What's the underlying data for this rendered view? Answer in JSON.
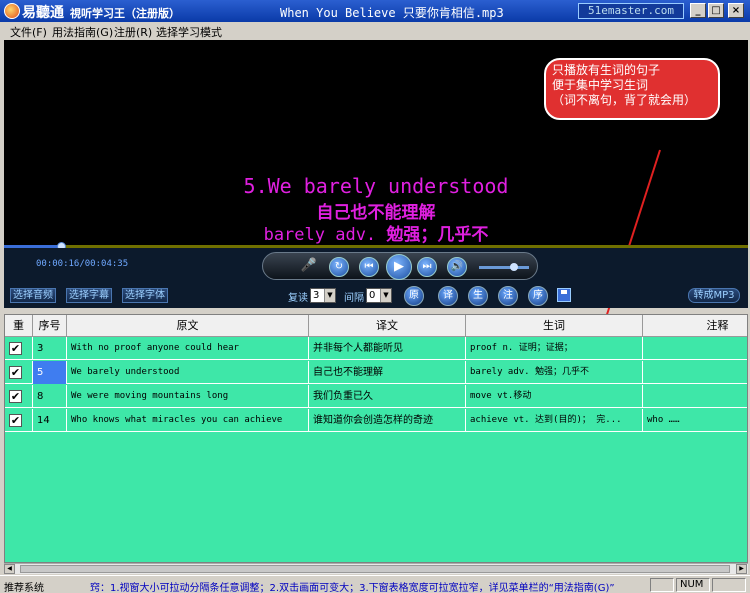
{
  "titlebar": {
    "app_name": "易聽通",
    "app_subtitle": "視听学习王（注册版）",
    "document": "When You Believe 只要你肯相信.mp3",
    "brand": "51emaster.com",
    "min": "_",
    "max": "□",
    "close": "×"
  },
  "menu": {
    "items": [
      "文件(F)",
      "用法指南(G)",
      "注册(R)",
      "选择学习模式"
    ]
  },
  "subtitles": {
    "line1": "5.We barely understood",
    "line2": "自己也不能理解",
    "line3_word": "barely adv.",
    "line3_def": "勉强；几乎不"
  },
  "callout": {
    "line1": "只播放有生词的句子",
    "line2": "便于集中学习生词",
    "line3": "（词不离句，背了就会用）"
  },
  "player": {
    "time": "00:00:16/00:04:35",
    "progress": 0.077,
    "volume": 0.7,
    "buttons": {
      "mic": "🎤",
      "repeat": "↻",
      "prev": "⏮",
      "play": "▶",
      "next": "⏭",
      "volume": "🔊"
    }
  },
  "toolbar": {
    "select_audio": "选择音频",
    "select_subtitle": "选择字幕",
    "select_font": "选择字体",
    "repeat_label": "复读",
    "repeat_value": "3",
    "interval_label": "间隔",
    "interval_value": "0",
    "circle_buttons": [
      "原",
      "译",
      "生",
      "注",
      "序"
    ],
    "to_mp3": "转成MP3"
  },
  "table": {
    "headers": [
      "重",
      "序号",
      "原文",
      "译文",
      "生词",
      "注释"
    ],
    "rows": [
      {
        "checked": "✔",
        "num": "3",
        "original": "With no proof anyone could hear",
        "translation": "并非每个人都能听见",
        "vocab": "proof n. 证明；证据；",
        "note": ""
      },
      {
        "checked": "✔",
        "num": "5",
        "original": "We barely understood",
        "translation": "自己也不能理解",
        "vocab": "barely adv. 勉强；几乎不",
        "note": ""
      },
      {
        "checked": "✔",
        "num": "8",
        "original": "We were moving mountains long",
        "translation": "我们负重已久",
        "vocab": "move vt.移动",
        "note": ""
      },
      {
        "checked": "✔",
        "num": "14",
        "original": "Who knows what miracles you can achieve",
        "translation": "谁知道你会创造怎样的奇迹",
        "vocab": "achieve vt. 达到(目的)； 完...",
        "note": "who ……"
      }
    ]
  },
  "status": {
    "left": "推荐系统",
    "tip": "窍：1.视窗大小可拉动分隔条任意调整；2.双击画面可变大；3.下窗表格宽度可拉宽拉窄，详见菜单栏的“用法指南(G)”",
    "num": "NUM"
  },
  "colors": {
    "grid_bg": "#3ee7a8",
    "subtitle": "#e020e0",
    "callout": "#e03030",
    "selected_cell": "#3f7df0"
  }
}
